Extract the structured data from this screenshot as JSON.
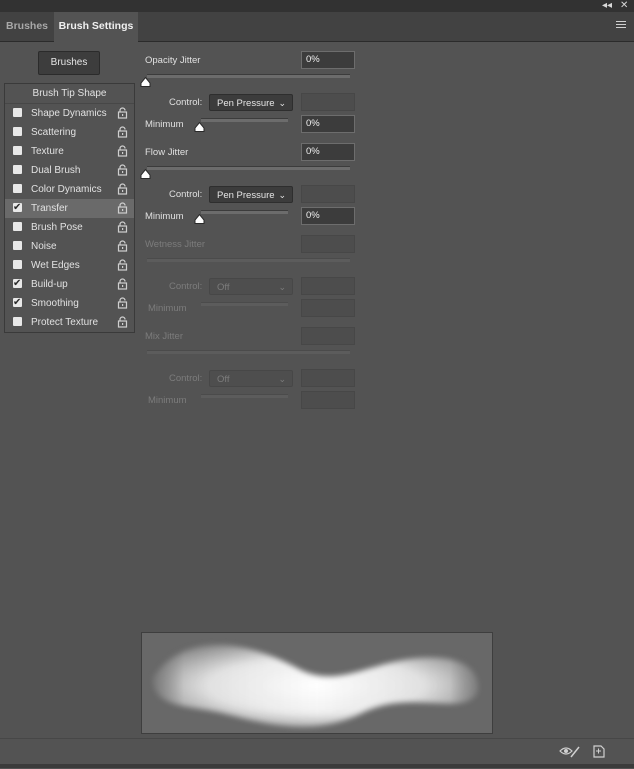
{
  "window": {
    "collapse_icon": "double-chevron-icon",
    "close_icon": "close-icon"
  },
  "tabs": [
    {
      "label": "Brushes",
      "active": false
    },
    {
      "label": "Brush Settings",
      "active": true
    }
  ],
  "panel_menu_icon": "hamburger-menu-icon",
  "brushes_button": "Brushes",
  "sidebar": {
    "header": "Brush Tip Shape",
    "items": [
      {
        "label": "Shape Dynamics",
        "checked": false,
        "locked_icon": "lock-icon"
      },
      {
        "label": "Scattering",
        "checked": false,
        "locked_icon": "lock-icon"
      },
      {
        "label": "Texture",
        "checked": false,
        "locked_icon": "lock-icon"
      },
      {
        "label": "Dual Brush",
        "checked": false,
        "locked_icon": "lock-icon"
      },
      {
        "label": "Color Dynamics",
        "checked": false,
        "locked_icon": "lock-icon"
      },
      {
        "label": "Transfer",
        "checked": true,
        "selected": true,
        "locked_icon": "lock-icon"
      },
      {
        "label": "Brush Pose",
        "checked": false,
        "locked_icon": "lock-icon"
      },
      {
        "label": "Noise",
        "checked": false,
        "locked_icon": "lock-icon"
      },
      {
        "label": "Wet Edges",
        "checked": false,
        "locked_icon": "lock-icon"
      },
      {
        "label": "Build-up",
        "checked": true,
        "locked_icon": "lock-icon"
      },
      {
        "label": "Smoothing",
        "checked": true,
        "locked_icon": "lock-icon"
      },
      {
        "label": "Protect Texture",
        "checked": false,
        "locked_icon": "lock-icon"
      }
    ]
  },
  "settings": {
    "opacity_jitter": {
      "label": "Opacity Jitter",
      "value": "0%",
      "slider_level": 0
    },
    "opacity_control": {
      "label": "Control:",
      "value": "Pen Pressure"
    },
    "opacity_minimum": {
      "label": "Minimum",
      "value": "0%",
      "slider_level": 0
    },
    "flow_jitter": {
      "label": "Flow Jitter",
      "value": "0%",
      "slider_level": 0
    },
    "flow_control": {
      "label": "Control:",
      "value": "Pen Pressure"
    },
    "flow_minimum": {
      "label": "Minimum",
      "value": "0%",
      "slider_level": 0
    },
    "wetness_jitter": {
      "label": "Wetness Jitter",
      "value": ""
    },
    "wetness_control": {
      "label": "Control:",
      "value": "Off"
    },
    "wetness_minimum": {
      "label": "Minimum",
      "value": ""
    },
    "mix_jitter": {
      "label": "Mix Jitter",
      "value": ""
    },
    "mix_control": {
      "label": "Control:",
      "value": "Off"
    },
    "mix_minimum": {
      "label": "Minimum",
      "value": ""
    }
  },
  "footer": {
    "toggle_preview_icon": "eye-pen-icon",
    "new_brush_icon": "new-document-icon"
  },
  "colors": {
    "panel_bg": "#535353",
    "tabbar_bg": "#424242",
    "input_bg": "#3c3c3c",
    "selected_row": "#6a6a6a"
  }
}
